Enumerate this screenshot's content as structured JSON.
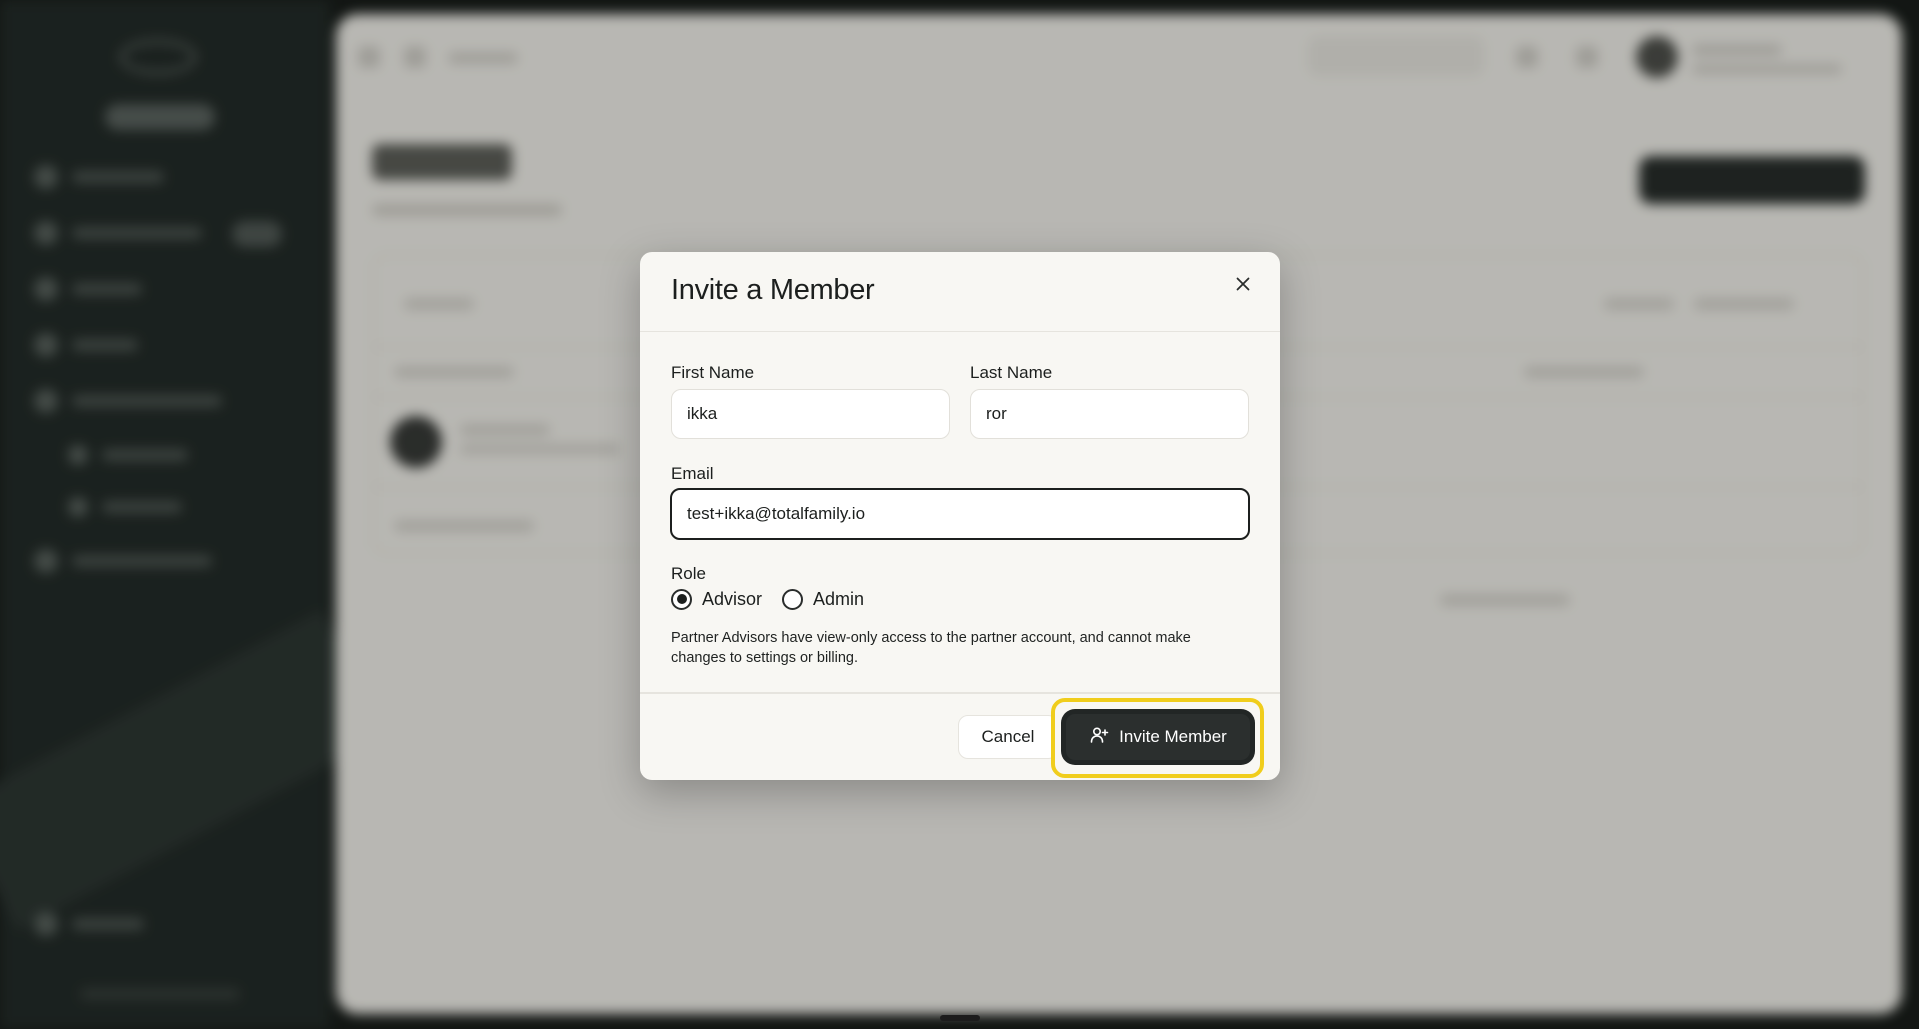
{
  "modal": {
    "title": "Invite a Member",
    "first_name": {
      "label": "First Name",
      "value": "ikka"
    },
    "last_name": {
      "label": "Last Name",
      "value": "ror"
    },
    "email": {
      "label": "Email",
      "value": "test+ikka@totalfamily.io"
    },
    "role": {
      "label": "Role",
      "options": [
        {
          "label": "Advisor",
          "selected": true
        },
        {
          "label": "Admin",
          "selected": false
        }
      ]
    },
    "help_text": "Partner Advisors have view-only access to the partner account, and cannot make changes to settings or billing.",
    "cancel_label": "Cancel",
    "invite_label": "Invite Member",
    "highlight_color": "#f0cd1c",
    "primary_color": "#2b2f2e"
  },
  "icons": {
    "close": "close-icon",
    "invite": "add-user-icon"
  }
}
